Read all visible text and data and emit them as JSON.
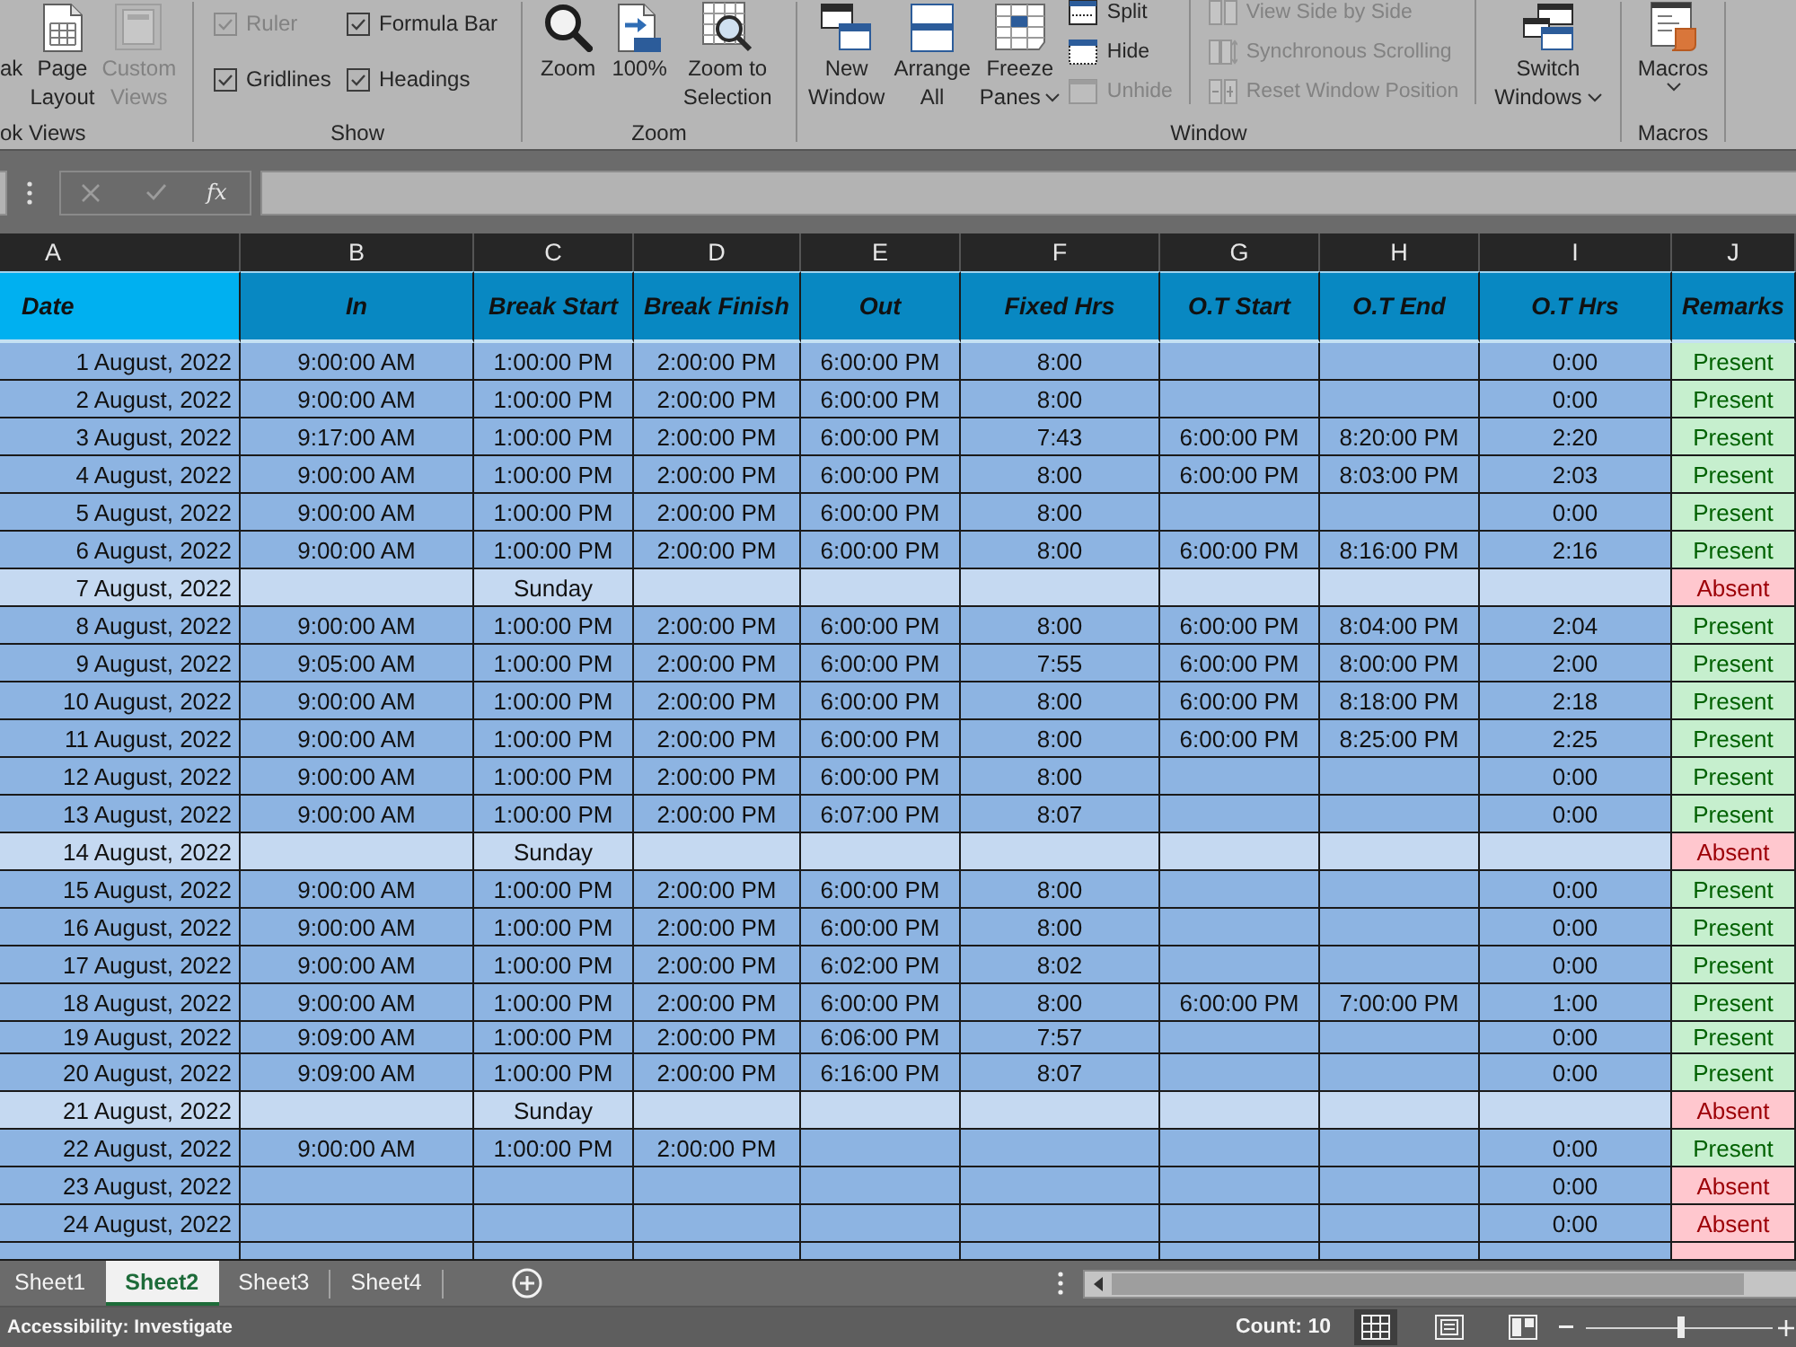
{
  "ribbon": {
    "groups": [
      {
        "label": "ok Views",
        "kind": "buttons",
        "items": [
          {
            "kind": "large",
            "lines": [
              "ak"
            ],
            "disabled": false,
            "dropdown": false
          },
          {
            "kind": "large",
            "lines": [
              "Page",
              "Layout"
            ],
            "disabled": false,
            "dropdown": false
          },
          {
            "kind": "large",
            "lines": [
              "Custom",
              "Views"
            ],
            "disabled": true,
            "dropdown": false
          }
        ]
      },
      {
        "label": "Show",
        "kind": "checkboxes",
        "items": [
          {
            "kind": "checkbox",
            "label": "Ruler",
            "checked": true,
            "disabled": true
          },
          {
            "kind": "checkbox",
            "label": "Formula Bar",
            "checked": true,
            "disabled": false
          },
          {
            "kind": "checkbox",
            "label": "Gridlines",
            "checked": true,
            "disabled": false
          },
          {
            "kind": "checkbox",
            "label": "Headings",
            "checked": true,
            "disabled": false
          }
        ]
      },
      {
        "label": "Zoom",
        "kind": "buttons",
        "items": [
          {
            "kind": "large",
            "lines": [
              "Zoom"
            ],
            "disabled": false,
            "dropdown": false
          },
          {
            "kind": "large",
            "lines": [
              "100%"
            ],
            "disabled": false,
            "dropdown": false
          },
          {
            "kind": "large",
            "lines": [
              "Zoom to",
              "Selection"
            ],
            "disabled": false,
            "dropdown": false
          }
        ]
      },
      {
        "label": "Window",
        "kind": "buttons",
        "items": [
          {
            "kind": "large",
            "lines": [
              "New",
              "Window"
            ],
            "disabled": false,
            "dropdown": false
          },
          {
            "kind": "large",
            "lines": [
              "Arrange",
              "All"
            ],
            "disabled": false,
            "dropdown": false
          },
          {
            "kind": "large",
            "lines": [
              "Freeze",
              "Panes"
            ],
            "disabled": false,
            "dropdown": true
          },
          {
            "kind": "stack",
            "items": [
              {
                "label": "Split",
                "disabled": false
              },
              {
                "label": "Hide",
                "disabled": false
              },
              {
                "label": "Unhide",
                "disabled": true
              }
            ]
          },
          {
            "kind": "stack",
            "items": [
              {
                "label": "View Side by Side",
                "disabled": true
              },
              {
                "label": "Synchronous Scrolling",
                "disabled": true
              },
              {
                "label": "Reset Window Position",
                "disabled": true
              }
            ]
          },
          {
            "kind": "large",
            "lines": [
              "Switch",
              "Windows"
            ],
            "disabled": false,
            "dropdown": true
          }
        ]
      },
      {
        "label": "Macros",
        "kind": "buttons",
        "items": [
          {
            "kind": "large",
            "lines": [
              "Macros"
            ],
            "disabled": false,
            "dropdown": true
          }
        ]
      }
    ]
  },
  "formula_bar": {
    "function_button": "fx"
  },
  "sheet": {
    "column_letters": [
      "A",
      "B",
      "C",
      "D",
      "E",
      "F",
      "G",
      "H",
      "I",
      "J"
    ],
    "columns": [
      {
        "label": "Date",
        "color": "#00b0f0"
      },
      {
        "label": "In",
        "color": "#0888c2"
      },
      {
        "label": "Break Start",
        "color": "#0888c2"
      },
      {
        "label": "Break Finish",
        "color": "#0888c2"
      },
      {
        "label": "Out",
        "color": "#0888c2"
      },
      {
        "label": "Fixed Hrs",
        "color": "#0888c2"
      },
      {
        "label": "O.T Start",
        "color": "#0888c2"
      },
      {
        "label": "O.T End",
        "color": "#0888c2"
      },
      {
        "label": "O.T Hrs",
        "color": "#0888c2"
      },
      {
        "label": "Remarks",
        "color": "#0888c2"
      }
    ],
    "rows": [
      {
        "date": "1 August, 2022",
        "in": "9:00:00 AM",
        "break_start": "1:00:00 PM",
        "break_finish": "2:00:00 PM",
        "out": "6:00:00 PM",
        "fixed_hrs": "8:00",
        "ot_hrs": "0:00",
        "remarks": {
          "label": "Present",
          "kind": "present"
        },
        "kind": "workday"
      },
      {
        "date": "2 August, 2022",
        "in": "9:00:00 AM",
        "break_start": "1:00:00 PM",
        "break_finish": "2:00:00 PM",
        "out": "6:00:00 PM",
        "fixed_hrs": "8:00",
        "ot_hrs": "0:00",
        "remarks": {
          "label": "Present",
          "kind": "present"
        },
        "kind": "workday"
      },
      {
        "date": "3 August, 2022",
        "in": "9:17:00 AM",
        "break_start": "1:00:00 PM",
        "break_finish": "2:00:00 PM",
        "out": "6:00:00 PM",
        "fixed_hrs": "7:43",
        "ot_start": "6:00:00 PM",
        "ot_end": "8:20:00 PM",
        "ot_hrs": "2:20",
        "remarks": {
          "label": "Present",
          "kind": "present"
        },
        "kind": "workday"
      },
      {
        "date": "4 August, 2022",
        "in": "9:00:00 AM",
        "break_start": "1:00:00 PM",
        "break_finish": "2:00:00 PM",
        "out": "6:00:00 PM",
        "fixed_hrs": "8:00",
        "ot_start": "6:00:00 PM",
        "ot_end": "8:03:00 PM",
        "ot_hrs": "2:03",
        "remarks": {
          "label": "Present",
          "kind": "present"
        },
        "kind": "workday"
      },
      {
        "date": "5 August, 2022",
        "in": "9:00:00 AM",
        "break_start": "1:00:00 PM",
        "break_finish": "2:00:00 PM",
        "out": "6:00:00 PM",
        "fixed_hrs": "8:00",
        "ot_hrs": "0:00",
        "remarks": {
          "label": "Present",
          "kind": "present"
        },
        "kind": "workday"
      },
      {
        "date": "6 August, 2022",
        "in": "9:00:00 AM",
        "break_start": "1:00:00 PM",
        "break_finish": "2:00:00 PM",
        "out": "6:00:00 PM",
        "fixed_hrs": "8:00",
        "ot_start": "6:00:00 PM",
        "ot_end": "8:16:00 PM",
        "ot_hrs": "2:16",
        "remarks": {
          "label": "Present",
          "kind": "present"
        },
        "kind": "workday"
      },
      {
        "date": "7 August, 2022",
        "break_start": "Sunday",
        "remarks": {
          "label": "Absent",
          "kind": "absent"
        },
        "kind": "sunday"
      },
      {
        "date": "8 August, 2022",
        "in": "9:00:00 AM",
        "break_start": "1:00:00 PM",
        "break_finish": "2:00:00 PM",
        "out": "6:00:00 PM",
        "fixed_hrs": "8:00",
        "ot_start": "6:00:00 PM",
        "ot_end": "8:04:00 PM",
        "ot_hrs": "2:04",
        "remarks": {
          "label": "Present",
          "kind": "present"
        },
        "kind": "workday"
      },
      {
        "date": "9 August, 2022",
        "in": "9:05:00 AM",
        "break_start": "1:00:00 PM",
        "break_finish": "2:00:00 PM",
        "out": "6:00:00 PM",
        "fixed_hrs": "7:55",
        "ot_start": "6:00:00 PM",
        "ot_end": "8:00:00 PM",
        "ot_hrs": "2:00",
        "remarks": {
          "label": "Present",
          "kind": "present"
        },
        "kind": "workday"
      },
      {
        "date": "10 August, 2022",
        "in": "9:00:00 AM",
        "break_start": "1:00:00 PM",
        "break_finish": "2:00:00 PM",
        "out": "6:00:00 PM",
        "fixed_hrs": "8:00",
        "ot_start": "6:00:00 PM",
        "ot_end": "8:18:00 PM",
        "ot_hrs": "2:18",
        "remarks": {
          "label": "Present",
          "kind": "present"
        },
        "kind": "workday"
      },
      {
        "date": "11 August, 2022",
        "in": "9:00:00 AM",
        "break_start": "1:00:00 PM",
        "break_finish": "2:00:00 PM",
        "out": "6:00:00 PM",
        "fixed_hrs": "8:00",
        "ot_start": "6:00:00 PM",
        "ot_end": "8:25:00 PM",
        "ot_hrs": "2:25",
        "remarks": {
          "label": "Present",
          "kind": "present"
        },
        "kind": "workday"
      },
      {
        "date": "12 August, 2022",
        "in": "9:00:00 AM",
        "break_start": "1:00:00 PM",
        "break_finish": "2:00:00 PM",
        "out": "6:00:00 PM",
        "fixed_hrs": "8:00",
        "ot_hrs": "0:00",
        "remarks": {
          "label": "Present",
          "kind": "present"
        },
        "kind": "workday"
      },
      {
        "date": "13 August, 2022",
        "in": "9:00:00 AM",
        "break_start": "1:00:00 PM",
        "break_finish": "2:00:00 PM",
        "out": "6:07:00 PM",
        "fixed_hrs": "8:07",
        "ot_hrs": "0:00",
        "remarks": {
          "label": "Present",
          "kind": "present"
        },
        "kind": "workday"
      },
      {
        "date": "14 August, 2022",
        "break_start": "Sunday",
        "remarks": {
          "label": "Absent",
          "kind": "absent"
        },
        "kind": "sunday"
      },
      {
        "date": "15 August, 2022",
        "in": "9:00:00 AM",
        "break_start": "1:00:00 PM",
        "break_finish": "2:00:00 PM",
        "out": "6:00:00 PM",
        "fixed_hrs": "8:00",
        "ot_hrs": "0:00",
        "remarks": {
          "label": "Present",
          "kind": "present"
        },
        "kind": "workday"
      },
      {
        "date": "16 August, 2022",
        "in": "9:00:00 AM",
        "break_start": "1:00:00 PM",
        "break_finish": "2:00:00 PM",
        "out": "6:00:00 PM",
        "fixed_hrs": "8:00",
        "ot_hrs": "0:00",
        "remarks": {
          "label": "Present",
          "kind": "present"
        },
        "kind": "workday"
      },
      {
        "date": "17 August, 2022",
        "in": "9:00:00 AM",
        "break_start": "1:00:00 PM",
        "break_finish": "2:00:00 PM",
        "out": "6:02:00 PM",
        "fixed_hrs": "8:02",
        "ot_hrs": "0:00",
        "remarks": {
          "label": "Present",
          "kind": "present"
        },
        "kind": "workday"
      },
      {
        "date": "18 August, 2022",
        "in": "9:00:00 AM",
        "break_start": "1:00:00 PM",
        "break_finish": "2:00:00 PM",
        "out": "6:00:00 PM",
        "fixed_hrs": "8:00",
        "ot_start": "6:00:00 PM",
        "ot_end": "7:00:00 PM",
        "ot_hrs": "1:00",
        "remarks": {
          "label": "Present",
          "kind": "present"
        },
        "kind": "workday"
      },
      {
        "date": "19 August, 2022",
        "in": "9:09:00 AM",
        "break_start": "1:00:00 PM",
        "break_finish": "2:00:00 PM",
        "out": "6:06:00 PM",
        "fixed_hrs": "7:57",
        "ot_hrs": "0:00",
        "remarks": {
          "label": "Present",
          "kind": "present"
        },
        "kind": "workday"
      },
      {
        "date": "20 August, 2022",
        "in": "9:09:00 AM",
        "break_start": "1:00:00 PM",
        "break_finish": "2:00:00 PM",
        "out": "6:16:00 PM",
        "fixed_hrs": "8:07",
        "ot_hrs": "0:00",
        "remarks": {
          "label": "Present",
          "kind": "present"
        },
        "kind": "workday"
      },
      {
        "date": "21 August, 2022",
        "break_start": "Sunday",
        "remarks": {
          "label": "Absent",
          "kind": "absent"
        },
        "kind": "sunday"
      },
      {
        "date": "22 August, 2022",
        "in": "9:00:00 AM",
        "break_start": "1:00:00 PM",
        "break_finish": "2:00:00 PM",
        "ot_hrs": "0:00",
        "remarks": {
          "label": "Present",
          "kind": "present"
        },
        "kind": "workday"
      },
      {
        "date": "23 August, 2022",
        "ot_hrs": "0:00",
        "remarks": {
          "label": "Absent",
          "kind": "absent"
        },
        "kind": "workday"
      },
      {
        "date": "24 August, 2022",
        "ot_hrs": "0:00",
        "remarks": {
          "label": "Absent",
          "kind": "absent"
        },
        "kind": "workday"
      }
    ],
    "partial_row": {
      "kind": "workday",
      "remarks": {
        "kind": "absent"
      }
    }
  },
  "sheet_tabs": [
    {
      "label": "Sheet1",
      "selected": false
    },
    {
      "label": "Sheet2",
      "selected": true
    },
    {
      "label": "Sheet3",
      "selected": false
    },
    {
      "label": "Sheet4",
      "selected": false
    }
  ],
  "status_bar": {
    "accessibility": "Accessibility: Investigate",
    "count": "Count: 10",
    "views": [
      {
        "kind": "normal",
        "selected": true
      },
      {
        "kind": "page-layout",
        "selected": false
      },
      {
        "kind": "page-break",
        "selected": false
      }
    ],
    "zoom": {
      "level": 0.51
    }
  }
}
